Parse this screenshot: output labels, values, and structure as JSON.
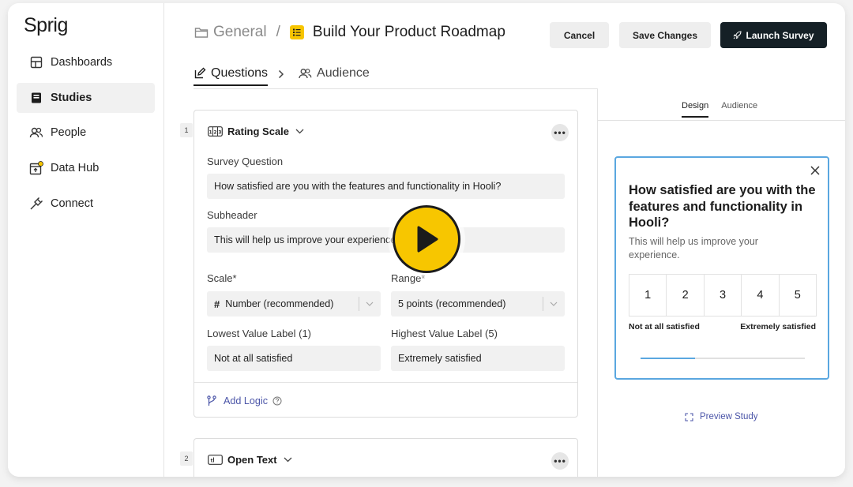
{
  "app": {
    "logo": "Sprig"
  },
  "sidebar": {
    "items": [
      {
        "label": "Dashboards",
        "icon": "dashboard-icon",
        "active": false
      },
      {
        "label": "Studies",
        "icon": "studies-icon",
        "active": true
      },
      {
        "label": "People",
        "icon": "people-icon",
        "active": false
      },
      {
        "label": "Data Hub",
        "icon": "data-hub-icon",
        "active": false
      },
      {
        "label": "Connect",
        "icon": "plug-icon",
        "active": false
      }
    ]
  },
  "header": {
    "breadcrumb_folder": "General",
    "breadcrumb_separator": "/",
    "title": "Build Your Product Roadmap",
    "cancel_label": "Cancel",
    "save_label": "Save Changes",
    "launch_label": "Launch Survey"
  },
  "tabs": {
    "questions": "Questions",
    "audience": "Audience"
  },
  "questions": [
    {
      "number": "1",
      "type_label": "Rating Scale",
      "survey_question_label": "Survey Question",
      "survey_question_value": "How satisfied are you with the features and functionality in Hooli?",
      "subheader_label": "Subheader",
      "subheader_value": "This will help us improve your experience.",
      "scale_label": "Scale*",
      "scale_value": "Number (recommended)",
      "range_label": "Range*",
      "range_value": "5 points (recommended)",
      "lowest_label": "Lowest Value Label (1)",
      "lowest_value": "Not at all satisfied",
      "highest_label": "Highest Value Label (5)",
      "highest_value": "Extremely satisfied",
      "add_logic_label": "Add Logic"
    },
    {
      "number": "2",
      "type_label": "Open Text"
    }
  ],
  "preview": {
    "tab_design": "Design",
    "tab_audience": "Audience",
    "question": "How satisfied are you with the features and functionality in Hooli?",
    "subheader": "This will help us improve your experience.",
    "scale": [
      "1",
      "2",
      "3",
      "4",
      "5"
    ],
    "low_label": "Not at all satisfied",
    "high_label": "Extremely satisfied",
    "progress_fraction": 0.33,
    "preview_study_label": "Preview Study"
  },
  "colors": {
    "accent_yellow": "#f7c600",
    "launch_button": "#152026",
    "preview_border": "#5aa7e0",
    "link": "#4b55a8"
  }
}
